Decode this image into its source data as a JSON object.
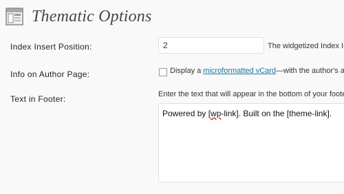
{
  "page": {
    "title": "Thematic Options",
    "icon": "options-page-icon"
  },
  "index_insert": {
    "label": "Index Insert Position:",
    "value": "2",
    "description": "The widgetized Index In"
  },
  "author_info": {
    "label": "Info on Author Page:",
    "checked": false,
    "text_before": "Display a ",
    "link_text": "microformatted vCard",
    "text_after": "—with the author's av"
  },
  "footer_text": {
    "label": "Text in Footer:",
    "description": "Enter the text that will appear in the bottom of your footer.",
    "value_before": "Powered by [",
    "value_wp": "wp",
    "value_after": "-link]. Built on the [theme-link]."
  },
  "colors": {
    "background": "#f9f9f9",
    "link": "#21759b",
    "title": "#464646"
  }
}
